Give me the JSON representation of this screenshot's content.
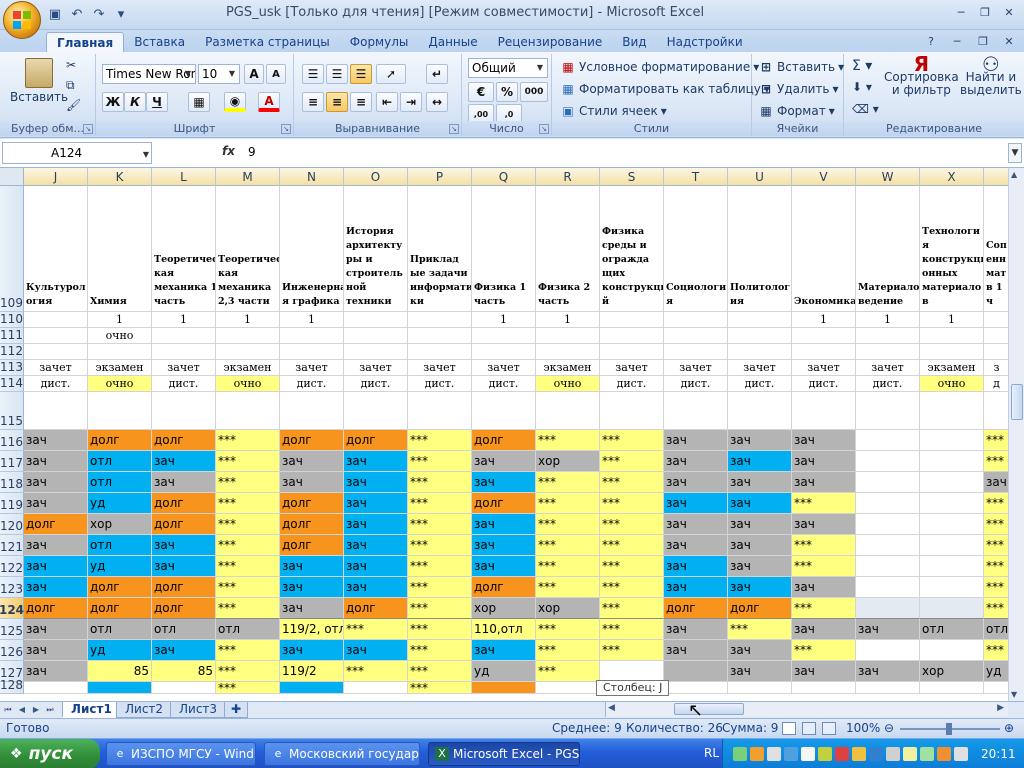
{
  "window": {
    "title": "PGS_usk  [Только для чтения]  [Режим совместимости] - Microsoft Excel"
  },
  "ribbon_tabs": [
    "Главная",
    "Вставка",
    "Разметка страницы",
    "Формулы",
    "Данные",
    "Рецензирование",
    "Вид",
    "Надстройки"
  ],
  "ribbon": {
    "clipboard": {
      "label": "Буфер обм...",
      "paste": "Вставить"
    },
    "font": {
      "label": "Шрифт",
      "font_name": "Times New Rom",
      "font_size": "10"
    },
    "alignment": {
      "label": "Выравнивание"
    },
    "number": {
      "label": "Число",
      "format": "Общий"
    },
    "styles": {
      "label": "Стили",
      "conditional": "Условное форматирование",
      "as_table": "Форматировать как таблицу",
      "cell_styles": "Стили ячеек"
    },
    "cells": {
      "label": "Ячейки",
      "insert": "Вставить",
      "delete": "Удалить",
      "format": "Формат"
    },
    "editing": {
      "label": "Редактирование",
      "sort": "Сортировка",
      "sort2": "и фильтр",
      "find": "Найти и",
      "find2": "выделить"
    }
  },
  "formula_bar": {
    "name_box": "A124",
    "fx": "fx",
    "value": "9"
  },
  "columns": [
    {
      "letter": "J",
      "w": 64
    },
    {
      "letter": "K",
      "w": 64
    },
    {
      "letter": "L",
      "w": 64
    },
    {
      "letter": "M",
      "w": 64
    },
    {
      "letter": "N",
      "w": 64
    },
    {
      "letter": "O",
      "w": 64
    },
    {
      "letter": "P",
      "w": 64
    },
    {
      "letter": "Q",
      "w": 64
    },
    {
      "letter": "R",
      "w": 64
    },
    {
      "letter": "S",
      "w": 64
    },
    {
      "letter": "T",
      "w": 64
    },
    {
      "letter": "U",
      "w": 64
    },
    {
      "letter": "V",
      "w": 64
    },
    {
      "letter": "W",
      "w": 64
    },
    {
      "letter": "X",
      "w": 64
    },
    {
      "letter": "",
      "w": 26
    }
  ],
  "rows": [
    {
      "num": "109",
      "h": 126,
      "kind": "hdr",
      "cells": [
        "Культурол\nогия",
        "Химия",
        "Теоретичес\nкая\nмеханика 1\nчасть",
        "Теоретичес\nкая\nмеханика\n2,3 части",
        "Инженерна\nя графика",
        "История\nархитекту\nры и\nстроитель\nной\nтехники",
        "Приклад\nые задачи\nинформати\nки",
        "Физика 1\nчасть",
        "Физика 2\nчасть",
        "Физика\nсреды и\nогражда\nщих\nконструкци\nй",
        "Социологи\nя",
        "Политолог\nия",
        "Экономика",
        "Материало\nведение",
        "Технологи\nя\nконструкци\nонных\nматериало\nв",
        "Соп\nенн\nмат\nв 1 ч"
      ]
    },
    {
      "num": "110",
      "h": 16,
      "kind": "serif",
      "cells": [
        "",
        "1",
        "1",
        "1",
        "1",
        "",
        "",
        "1",
        "1",
        "",
        "",
        "",
        "1",
        "1",
        "1",
        ""
      ]
    },
    {
      "num": "111",
      "h": 16,
      "kind": "serif",
      "cells": [
        "",
        "очно",
        "",
        "",
        "",
        "",
        "",
        "",
        "",
        "",
        "",
        "",
        "",
        "",
        "",
        ""
      ]
    },
    {
      "num": "112",
      "h": 16,
      "kind": "serif",
      "cells": [
        "",
        "",
        "",
        "",
        "",
        "",
        "",
        "",
        "",
        "",
        "",
        "",
        "",
        "",
        "",
        ""
      ]
    },
    {
      "num": "113",
      "h": 16,
      "kind": "serif",
      "cells": [
        "зачет",
        "экзамен",
        "зачет",
        "экзамен",
        "зачет",
        "зачет",
        "зачет",
        "зачет",
        "экзамен",
        "зачет",
        "зачет",
        "зачет",
        "зачет",
        "зачет",
        "экзамен",
        "з"
      ]
    },
    {
      "num": "114",
      "h": 16,
      "kind": "serif",
      "cells": [
        "дист.",
        "очно",
        "дист.",
        "очно",
        "дист.",
        "дист.",
        "дист.",
        "дист.",
        "очно",
        "дист.",
        "дист.",
        "дист.",
        "дист.",
        "дист.",
        "очно",
        "д"
      ]
    },
    {
      "num": "115",
      "h": 38,
      "kind": "serif",
      "cells": [
        "",
        "",
        "",
        "",
        "",
        "",
        "",
        "",
        "",
        "",
        "",
        "",
        "",
        "",
        "",
        ""
      ]
    },
    {
      "num": "116",
      "h": 21,
      "kind": "data",
      "cells": [
        "зач",
        "долг",
        "долг",
        "***",
        "долг",
        "долг",
        "***",
        "долг",
        "***",
        "***",
        "зач",
        "зач",
        "зач",
        "",
        "",
        "***"
      ]
    },
    {
      "num": "117",
      "h": 21,
      "kind": "data",
      "cells": [
        "зач",
        "отл",
        "зач",
        "***",
        "зач",
        "зач",
        "***",
        "зач",
        "хор",
        "***",
        "зач",
        "зач",
        "зач",
        "",
        "",
        "***"
      ]
    },
    {
      "num": "118",
      "h": 21,
      "kind": "data",
      "cells": [
        "зач",
        "отл",
        "зач",
        "***",
        "зач",
        "зач",
        "***",
        "зач",
        "***",
        "***",
        "зач",
        "зач",
        "зач",
        "",
        "",
        "зач"
      ]
    },
    {
      "num": "119",
      "h": 21,
      "kind": "data",
      "cells": [
        "зач",
        "уд",
        "долг",
        "***",
        "долг",
        "зач",
        "***",
        "долг",
        "***",
        "***",
        "зач",
        "зач",
        "***",
        "",
        "",
        "***"
      ]
    },
    {
      "num": "120",
      "h": 21,
      "kind": "data",
      "cells": [
        "долг",
        "хор",
        "долг",
        "***",
        "долг",
        "зач",
        "***",
        "зач",
        "***",
        "***",
        "зач",
        "зач",
        "зач",
        "",
        "",
        "***"
      ]
    },
    {
      "num": "121",
      "h": 21,
      "kind": "data",
      "cells": [
        "зач",
        "отл",
        "зач",
        "***",
        "долг",
        "зач",
        "***",
        "зач",
        "***",
        "***",
        "зач",
        "зач",
        "***",
        "",
        "",
        "***"
      ]
    },
    {
      "num": "122",
      "h": 21,
      "kind": "data",
      "cells": [
        "зач",
        "уд",
        "зач",
        "***",
        "зач",
        "зач",
        "***",
        "зач",
        "***",
        "***",
        "зач",
        "зач",
        "***",
        "",
        "",
        "***"
      ]
    },
    {
      "num": "123",
      "h": 21,
      "kind": "data",
      "cells": [
        "зач",
        "долг",
        "долг",
        "***",
        "зач",
        "зач",
        "***",
        "долг",
        "***",
        "***",
        "зач",
        "зач",
        "зач",
        "",
        "",
        "***"
      ]
    },
    {
      "num": "124",
      "h": 21,
      "kind": "data",
      "sel": true,
      "cells": [
        "долг",
        "долг",
        "долг",
        "***",
        "зач",
        "долг",
        "***",
        "хор",
        "хор",
        "***",
        "долг",
        "долг",
        "***",
        "",
        "",
        "***"
      ]
    },
    {
      "num": "125",
      "h": 21,
      "kind": "data",
      "cells": [
        "зач",
        "отл",
        "отл",
        "отл",
        "119/2, отл",
        "***",
        "***",
        "110,отл",
        "***",
        "***",
        "зач",
        "***",
        "зач",
        "зач",
        "отл",
        "отл"
      ]
    },
    {
      "num": "126",
      "h": 21,
      "kind": "data",
      "cells": [
        "зач",
        "уд",
        "зач",
        "***",
        "зач",
        "зач",
        "***",
        "зач",
        "***",
        "***",
        "зач",
        "зач",
        "***",
        "",
        "",
        "***"
      ]
    },
    {
      "num": "127",
      "h": 21,
      "kind": "data",
      "cells": [
        "зач",
        "85",
        "85",
        "***",
        "119/2",
        "***",
        "***",
        "уд",
        "***",
        "",
        "",
        "зач",
        "зач",
        "зач",
        "хор",
        "уд"
      ]
    },
    {
      "num": "128",
      "h": 12,
      "kind": "data",
      "cells": [
        "",
        "",
        "",
        "***",
        "",
        "",
        "***",
        "",
        "",
        "",
        "",
        "",
        "",
        "",
        "",
        ""
      ]
    }
  ],
  "fills": [
    [
      "#ffffff",
      "#ffffff",
      "#ffffff",
      "#ffffff",
      "#ffffff",
      "#ffffff",
      "#ffffff",
      "#ffffff",
      "#ffffff",
      "#ffffff",
      "#ffffff",
      "#ffffff",
      "#ffffff",
      "#ffffff",
      "#ffffff",
      "#ffffff"
    ],
    [
      "#ffffff",
      "#ffffff",
      "#ffffff",
      "#ffffff",
      "#ffffff",
      "#ffffff",
      "#ffffff",
      "#ffffff",
      "#ffffff",
      "#ffffff",
      "#ffffff",
      "#ffffff",
      "#ffffff",
      "#ffffff",
      "#ffffff",
      "#ffffff"
    ],
    [
      "#ffffff",
      "#ffffff",
      "#ffffff",
      "#ffffff",
      "#ffffff",
      "#ffffff",
      "#ffffff",
      "#ffffff",
      "#ffffff",
      "#ffffff",
      "#ffffff",
      "#ffffff",
      "#ffffff",
      "#ffffff",
      "#ffffff",
      "#ffffff"
    ],
    [
      "#ffffff",
      "#ffffff",
      "#ffffff",
      "#ffffff",
      "#ffffff",
      "#ffffff",
      "#ffffff",
      "#ffffff",
      "#ffffff",
      "#ffffff",
      "#ffffff",
      "#ffffff",
      "#ffffff",
      "#ffffff",
      "#ffffff",
      "#ffffff"
    ],
    [
      "#ffffff",
      "#ffffff",
      "#ffffff",
      "#ffffff",
      "#ffffff",
      "#ffffff",
      "#ffffff",
      "#ffffff",
      "#ffffff",
      "#ffffff",
      "#ffffff",
      "#ffffff",
      "#ffffff",
      "#ffffff",
      "#ffffff",
      "#ffffff"
    ],
    [
      "#ffffff",
      "#ffff80",
      "#ffffff",
      "#ffff80",
      "#ffffff",
      "#ffffff",
      "#ffffff",
      "#ffffff",
      "#ffff80",
      "#ffffff",
      "#ffffff",
      "#ffffff",
      "#ffffff",
      "#ffffff",
      "#ffff80",
      "#ffffff"
    ],
    [
      "#ffffff",
      "#ffffff",
      "#ffffff",
      "#ffffff",
      "#ffffff",
      "#ffffff",
      "#ffffff",
      "#ffffff",
      "#ffffff",
      "#ffffff",
      "#ffffff",
      "#ffffff",
      "#ffffff",
      "#ffffff",
      "#ffffff",
      "#ffffff"
    ],
    [
      "#b4b4b4",
      "#f7941d",
      "#f7941d",
      "#ffff80",
      "#f7941d",
      "#f7941d",
      "#ffff80",
      "#f7941d",
      "#ffff80",
      "#ffff80",
      "#b4b4b4",
      "#b4b4b4",
      "#b4b4b4",
      "#ffffff",
      "#ffffff",
      "#ffff80"
    ],
    [
      "#b4b4b4",
      "#00b0f0",
      "#00b0f0",
      "#ffff80",
      "#b4b4b4",
      "#00b0f0",
      "#ffff80",
      "#b4b4b4",
      "#b4b4b4",
      "#ffff80",
      "#b4b4b4",
      "#00b0f0",
      "#b4b4b4",
      "#ffffff",
      "#ffffff",
      "#ffff80"
    ],
    [
      "#b4b4b4",
      "#00b0f0",
      "#b4b4b4",
      "#ffff80",
      "#b4b4b4",
      "#00b0f0",
      "#ffff80",
      "#00b0f0",
      "#ffff80",
      "#ffff80",
      "#b4b4b4",
      "#b4b4b4",
      "#b4b4b4",
      "#ffffff",
      "#ffffff",
      "#b4b4b4"
    ],
    [
      "#b4b4b4",
      "#00b0f0",
      "#f7941d",
      "#ffff80",
      "#f7941d",
      "#00b0f0",
      "#ffff80",
      "#f7941d",
      "#ffff80",
      "#ffff80",
      "#00b0f0",
      "#00b0f0",
      "#ffff80",
      "#ffffff",
      "#ffffff",
      "#ffff80"
    ],
    [
      "#f7941d",
      "#b4b4b4",
      "#f7941d",
      "#ffff80",
      "#f7941d",
      "#00b0f0",
      "#ffff80",
      "#00b0f0",
      "#ffff80",
      "#ffff80",
      "#b4b4b4",
      "#b4b4b4",
      "#b4b4b4",
      "#ffffff",
      "#ffffff",
      "#ffff80"
    ],
    [
      "#b4b4b4",
      "#00b0f0",
      "#00b0f0",
      "#ffff80",
      "#f7941d",
      "#00b0f0",
      "#ffff80",
      "#00b0f0",
      "#ffff80",
      "#ffff80",
      "#b4b4b4",
      "#b4b4b4",
      "#ffff80",
      "#ffffff",
      "#ffffff",
      "#ffff80"
    ],
    [
      "#00b0f0",
      "#00b0f0",
      "#00b0f0",
      "#ffff80",
      "#00b0f0",
      "#00b0f0",
      "#ffff80",
      "#00b0f0",
      "#ffff80",
      "#ffff80",
      "#00b0f0",
      "#b4b4b4",
      "#ffff80",
      "#ffffff",
      "#ffffff",
      "#ffff80"
    ],
    [
      "#00b0f0",
      "#f7941d",
      "#f7941d",
      "#ffff80",
      "#00b0f0",
      "#00b0f0",
      "#ffff80",
      "#f7941d",
      "#ffff80",
      "#ffff80",
      "#00b0f0",
      "#00b0f0",
      "#b4b4b4",
      "#ffffff",
      "#ffffff",
      "#ffff80"
    ],
    [
      "#f7941d",
      "#f7941d",
      "#f7941d",
      "#ffff80",
      "#b4b4b4",
      "#f7941d",
      "#ffff80",
      "#b4b4b4",
      "#b4b4b4",
      "#ffff80",
      "#f7941d",
      "#f7941d",
      "#ffff80",
      "#e4eaf2",
      "#e4eaf2",
      "#ffff80"
    ],
    [
      "#b4b4b4",
      "#b4b4b4",
      "#b4b4b4",
      "#b4b4b4",
      "#ffff80",
      "#ffff80",
      "#ffff80",
      "#ffff80",
      "#ffff80",
      "#ffff80",
      "#b4b4b4",
      "#ffff80",
      "#b4b4b4",
      "#b4b4b4",
      "#b4b4b4",
      "#b4b4b4"
    ],
    [
      "#b4b4b4",
      "#00b0f0",
      "#00b0f0",
      "#ffff80",
      "#00b0f0",
      "#00b0f0",
      "#ffff80",
      "#00b0f0",
      "#ffff80",
      "#ffff80",
      "#b4b4b4",
      "#b4b4b4",
      "#ffff80",
      "#ffffff",
      "#ffffff",
      "#ffff80"
    ],
    [
      "#b4b4b4",
      "#ffff80",
      "#ffff80",
      "#ffff80",
      "#ffff80",
      "#ffff80",
      "#ffff80",
      "#b4b4b4",
      "#ffff80",
      "#ffffff",
      "#b4b4b4",
      "#b4b4b4",
      "#b4b4b4",
      "#b4b4b4",
      "#b4b4b4",
      "#b4b4b4"
    ],
    [
      "#ffffff",
      "#00b0f0",
      "#ffffff",
      "#ffff80",
      "#00b0f0",
      "#ffffff",
      "#ffff80",
      "#f7941d",
      "#ffffff",
      "#ffffff",
      "#ffffff",
      "#ffffff",
      "#ffffff",
      "#ffffff",
      "#ffffff",
      "#ffffff"
    ]
  ],
  "sheet_tabs": [
    "Лист1",
    "Лист2",
    "Лист3"
  ],
  "tooltip": "Столбец: J",
  "status": {
    "ready": "Готово",
    "average": "Среднее: 9",
    "count": "Количество: 26",
    "sum": "Сумма: 9",
    "zoom": "100%"
  },
  "taskbar": {
    "start": "пуск",
    "buttons": [
      "ИЗСПО МГСУ - Wind...",
      "Московский государ...",
      "Microsoft Excel - PGS..."
    ],
    "lang": "RL",
    "clock": "20:11"
  },
  "colors": {
    "orange": "#f7941d",
    "cyan": "#00b0f0",
    "gray": "#b4b4b4",
    "yellow": "#ffff80"
  }
}
